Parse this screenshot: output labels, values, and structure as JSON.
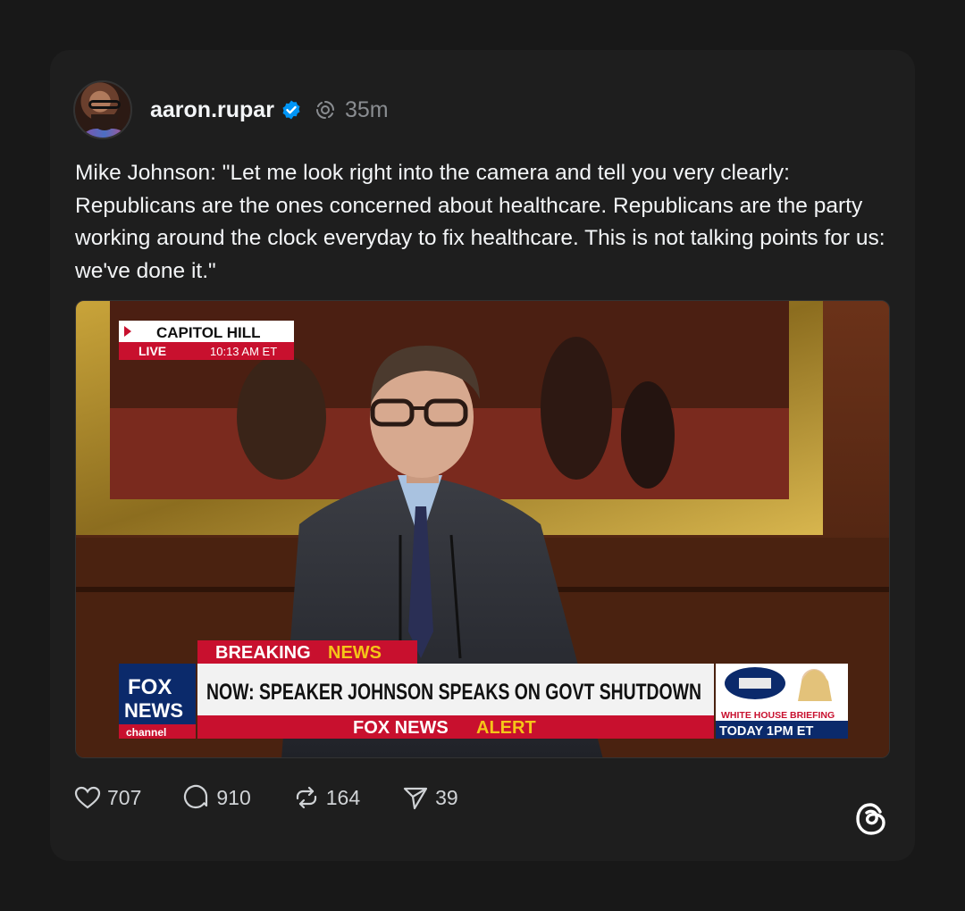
{
  "post": {
    "username": "aaron.rupar",
    "time": "35m",
    "text": "Mike Johnson: \"Let me look right into the camera and tell you very clearly: Republicans are the ones concerned about healthcare. Republicans are the party working around the clock everyday to fix healthcare. This is not talking points for us: we've done it.\"",
    "icons": {
      "verified": "verified-badge-icon",
      "status": "spinner-icon"
    }
  },
  "video": {
    "location": "CAPITOL HILL",
    "live": "LIVE",
    "time": "10:13 AM ET",
    "breaking_1": "BREAKING",
    "breaking_2": "NEWS",
    "headline": "NOW: SPEAKER JOHNSON SPEAKS ON GOVT SHUTDOWN",
    "alert_1": "FOX NEWS",
    "alert_2": "ALERT",
    "logo_fox": "FOX",
    "logo_news": "NEWS",
    "logo_channel": "channel",
    "promo_1": "WHITE HOUSE BRIEFING",
    "promo_2": "TODAY 1PM ET"
  },
  "actions": {
    "likes": "707",
    "replies": "910",
    "reposts": "164",
    "shares": "39"
  },
  "colors": {
    "accent": "#0095f6",
    "red": "#c8102e",
    "navy": "#0b2a6b",
    "gold": "#f5c518"
  }
}
